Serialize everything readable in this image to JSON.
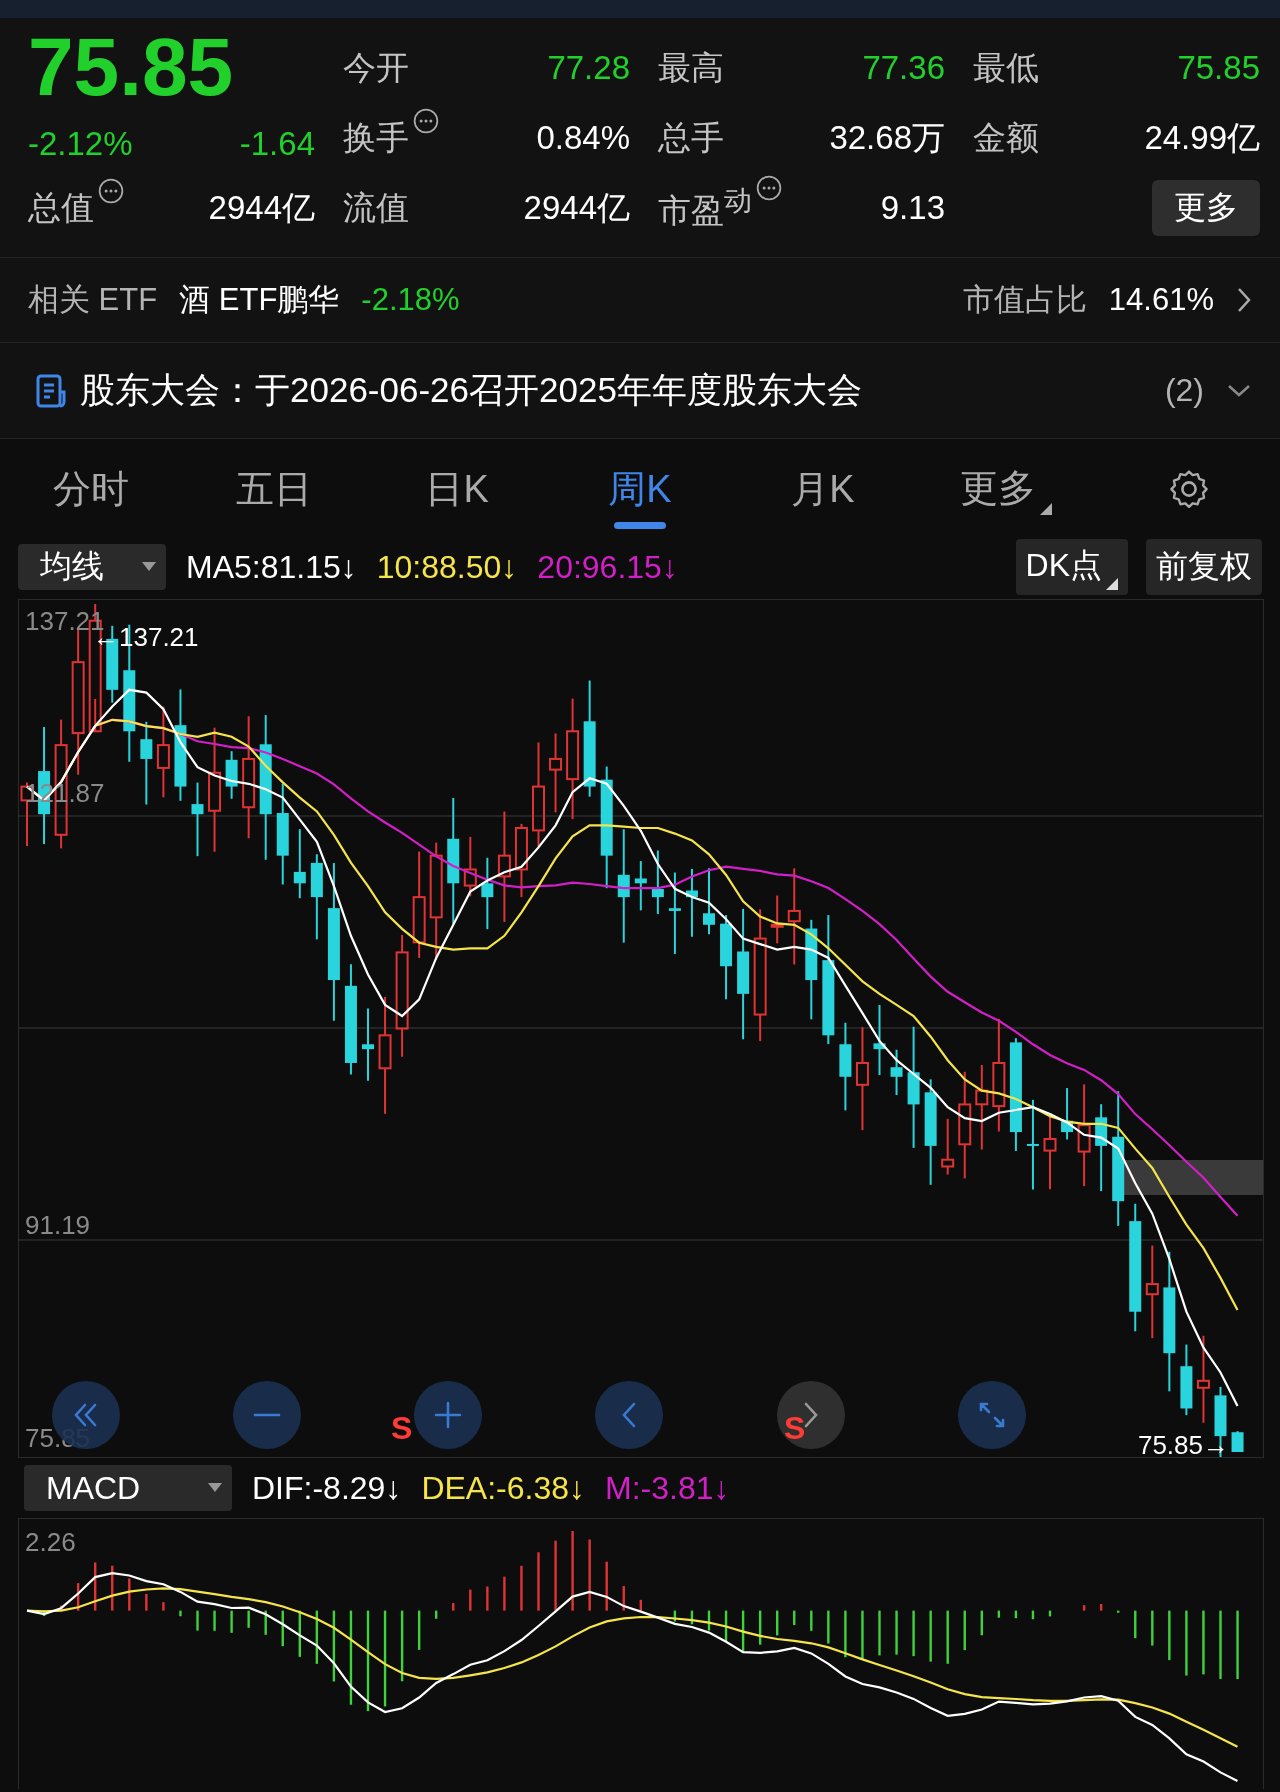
{
  "quote": {
    "price": "75.85",
    "change_pct": "-2.12%",
    "change": "-1.64"
  },
  "stats": [
    {
      "label": "今开",
      "value": "77.28",
      "falling": true,
      "info": false
    },
    {
      "label": "最高",
      "value": "77.36",
      "falling": true,
      "info": false
    },
    {
      "label": "最低",
      "value": "75.85",
      "falling": true,
      "info": false
    },
    {
      "label": "换手",
      "value": "0.84%",
      "falling": false,
      "info": true
    },
    {
      "label": "总手",
      "value": "32.68万",
      "falling": false,
      "info": false
    },
    {
      "label": "金额",
      "value": "24.99亿",
      "falling": false,
      "info": false
    },
    {
      "label": "总值",
      "value": "2944亿",
      "falling": false,
      "info": true
    },
    {
      "label": "流值",
      "value": "2944亿",
      "falling": false,
      "info": false
    },
    {
      "label": "市盈$^{动}$",
      "value": "9.13",
      "falling": false,
      "info": true
    }
  ],
  "more_button": "更多",
  "etf": {
    "label": "相关 ETF",
    "name": "酒 ETF鹏华",
    "change": "-2.18%",
    "share_label": "市值占比",
    "share": "14.61%"
  },
  "notice": {
    "text": "股东大会：于2026-06-26召开2025年年度股东大会",
    "count": "(2)"
  },
  "tabs": [
    {
      "label": "分时",
      "selected": false,
      "kind": "tab"
    },
    {
      "label": "五日",
      "selected": false,
      "kind": "tab"
    },
    {
      "label": "日K",
      "selected": false,
      "kind": "tab"
    },
    {
      "label": "周K",
      "selected": true,
      "kind": "tab"
    },
    {
      "label": "月K",
      "selected": false,
      "kind": "tab"
    },
    {
      "label": "更多",
      "selected": false,
      "kind": "menu"
    }
  ],
  "indicator": {
    "selector": "均线",
    "values": [
      {
        "label": "MA5:81.15↓",
        "color": "#ffffff"
      },
      {
        "label": "10:88.50↓",
        "color": "#f5e44a"
      },
      {
        "label": "20:96.15↓",
        "color": "#d21fc7"
      }
    ],
    "buttons": [
      {
        "label": "DK点",
        "kind": "menu"
      },
      {
        "label": "前复权",
        "kind": "plain"
      }
    ]
  },
  "chart": {
    "price_labels": [
      "137.21",
      "121.87",
      "91.19",
      "75.85"
    ],
    "high_marker": "←137.21",
    "last_marker": "75.85→",
    "signals": [
      "S",
      "S"
    ]
  },
  "controls": [
    {
      "kind": "rewind",
      "disabled": false
    },
    {
      "kind": "zoom-out",
      "disabled": false
    },
    {
      "kind": "zoom-in",
      "disabled": false
    },
    {
      "kind": "back",
      "disabled": false
    },
    {
      "kind": "forward",
      "disabled": true
    },
    {
      "kind": "fullscreen",
      "disabled": false
    }
  ],
  "macd": {
    "selector": "MACD",
    "values": [
      {
        "label": "DIF:-8.29↓",
        "color": "#ffffff"
      },
      {
        "label": "DEA:-6.38↓",
        "color": "#f5e44a"
      },
      {
        "label": "M:-3.81↓",
        "color": "#d21fc7"
      }
    ],
    "scale_label": "2.26"
  }
}
